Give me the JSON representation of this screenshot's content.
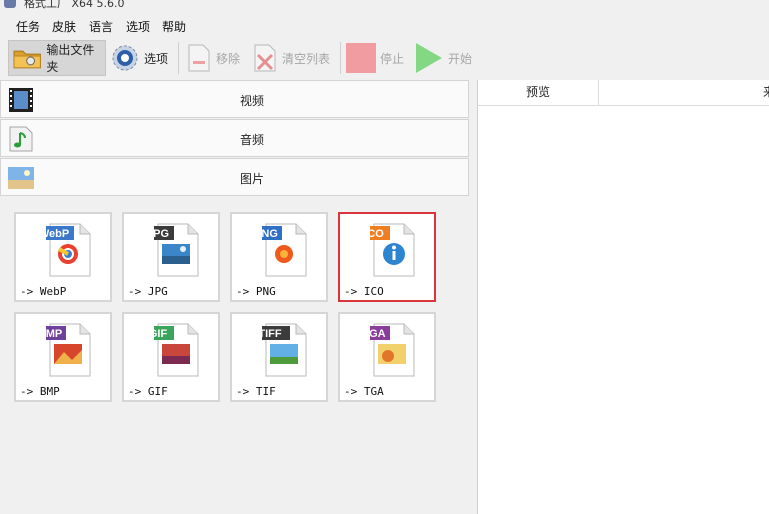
{
  "window": {
    "title": "格式工厂  X64 5.6.0"
  },
  "menu": [
    "任务",
    "皮肤",
    "语言",
    "选项",
    "帮助"
  ],
  "toolbar": {
    "output_folder": "输出文件夹",
    "options": "选项",
    "remove": "移除",
    "clear_list": "清空列表",
    "stop": "停止",
    "start": "开始"
  },
  "categories": {
    "video": "视频",
    "audio": "音频",
    "image": "图片"
  },
  "formats": [
    {
      "badge": "WebP",
      "caption": "-> WebP",
      "badge_color": "#3a78c9"
    },
    {
      "badge": "JPG",
      "caption": "-> JPG",
      "badge_color": "#3b3b3b"
    },
    {
      "badge": "PNG",
      "caption": "-> PNG",
      "badge_color": "#2f6fc4"
    },
    {
      "badge": "ICO",
      "caption": "-> ICO",
      "badge_color": "#ef7d22"
    },
    {
      "badge": "BMP",
      "caption": "-> BMP",
      "badge_color": "#6f3f9c"
    },
    {
      "badge": "GIF",
      "caption": "-> GIF",
      "badge_color": "#3aa55b"
    },
    {
      "badge": "TIFF",
      "caption": "-> TIF",
      "badge_color": "#3b3b3b"
    },
    {
      "badge": "TGA",
      "caption": "-> TGA",
      "badge_color": "#8a3d9a"
    }
  ],
  "list_columns": {
    "preview": "预览",
    "source": "来"
  },
  "colors": {
    "selected_border": "#d9353a",
    "stop": "#f19ca0",
    "start": "#7fd67f"
  }
}
